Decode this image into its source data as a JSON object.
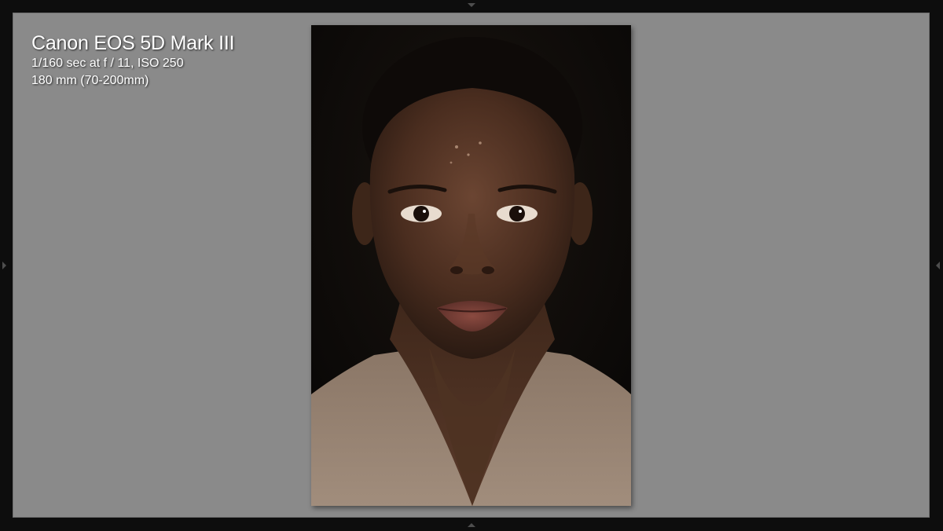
{
  "metadata_overlay": {
    "camera": "Canon EOS 5D Mark III",
    "exposure": "1/160 sec at f / 11, ISO 250",
    "lens": "180 mm (70-200mm)"
  },
  "photo": {
    "subject": "portrait-photo"
  },
  "colors": {
    "background": "#8a8a8a",
    "frame": "#0d0d0d",
    "text": "#ffffff"
  }
}
